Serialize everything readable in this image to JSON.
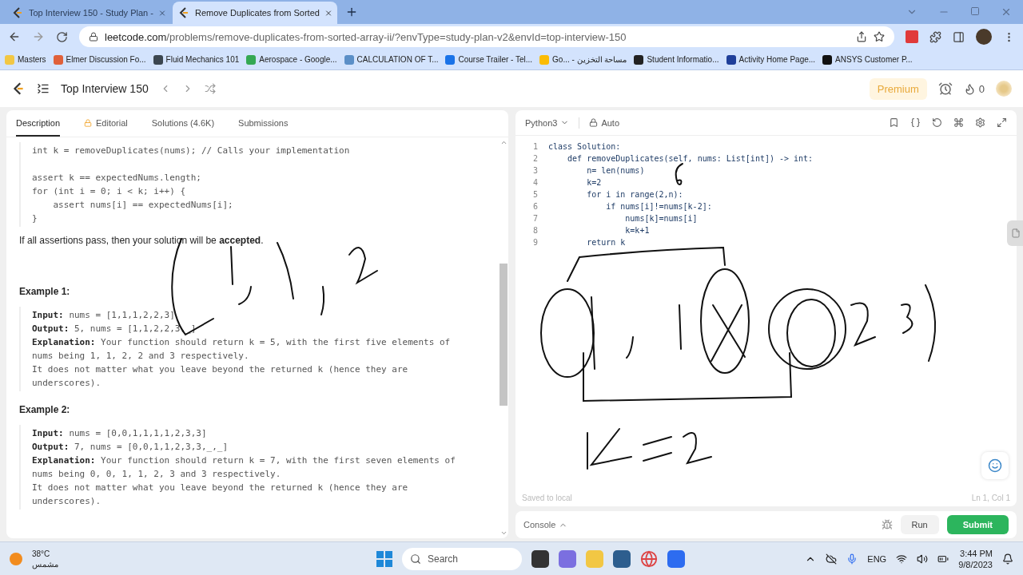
{
  "browser": {
    "tabs": [
      {
        "title": "Top Interview 150 - Study Plan -",
        "selected": false
      },
      {
        "title": "Remove Duplicates from Sorted",
        "selected": true
      }
    ],
    "url_host": "leetcode.com",
    "url_path": "/problems/remove-duplicates-from-sorted-array-ii/?envType=study-plan-v2&envId=top-interview-150",
    "bookmarks": [
      {
        "label": "Masters",
        "color": "#f2c744"
      },
      {
        "label": "Elmer Discussion Fo...",
        "color": "#e0603a"
      },
      {
        "label": "Fluid Mechanics 101",
        "color": "#3b4650"
      },
      {
        "label": "Aerospace - Google...",
        "color": "#34a853"
      },
      {
        "label": "CALCULATION OF T...",
        "color": "#5b8fc7"
      },
      {
        "label": "Course Trailer - Tel...",
        "color": "#1a73e8"
      },
      {
        "label": "Go... - مساحة التخزين",
        "color": "#fbbc04"
      },
      {
        "label": "Student Informatio...",
        "color": "#222222"
      },
      {
        "label": "Activity Home Page...",
        "color": "#1f3f9a"
      },
      {
        "label": "ANSYS Customer P...",
        "color": "#111111"
      }
    ]
  },
  "header": {
    "title": "Top Interview 150",
    "premium": "Premium",
    "streak": "0"
  },
  "description": {
    "tabs": [
      {
        "label": "Description",
        "selected": true,
        "locked": false
      },
      {
        "label": "Editorial",
        "selected": false,
        "locked": true
      },
      {
        "label": "Solutions (4.6K)",
        "selected": false,
        "locked": false
      },
      {
        "label": "Submissions",
        "selected": false,
        "locked": false
      }
    ],
    "code_groups": [
      [
        "int k = removeDuplicates(nums); // Calls your implementation"
      ],
      [
        "assert k == expectedNums.length;",
        "for (int i = 0; i < k; i++) {",
        "    assert nums[i] == expectedNums[i];",
        "}"
      ]
    ],
    "paragraph": "If all assertions pass, then your solution will be **accepted**.",
    "examples": [
      {
        "title": "Example 1:",
        "input_label": "Input:",
        "output_label": "Output:",
        "explanation_label": "Explanation:",
        "input": "nums = [1,1,1,2,2,3]",
        "output": "5, nums = [1,1,2,2,3,_]",
        "explanation": [
          "Your function should return k = 5, with the first five elements of",
          "nums being 1, 1, 2, 2 and 3 respectively.",
          "It does not matter what you leave beyond the returned k (hence they are",
          "underscores)."
        ]
      },
      {
        "title": "Example 2:",
        "input_label": "Input:",
        "output_label": "Output:",
        "explanation_label": "Explanation:",
        "input": "nums = [0,0,1,1,1,1,2,3,3]",
        "output": "7, nums = [0,0,1,1,2,3,3,_,_]",
        "explanation": [
          "Your function should return k = 7, with the first seven elements of",
          "nums being 0, 0, 1, 1, 2, 3 and 3 respectively.",
          "It does not matter what you leave beyond the returned k (hence they are",
          "underscores)."
        ]
      }
    ]
  },
  "editor": {
    "language": "Python3",
    "mode": "Auto",
    "lines": [
      {
        "number": "1",
        "text": "class Solution:"
      },
      {
        "number": "2",
        "text": "    def removeDuplicates(self, nums: List[int]) -> int:"
      },
      {
        "number": "3",
        "text": "        n= len(nums)"
      },
      {
        "number": "4",
        "text": "        k=2"
      },
      {
        "number": "5",
        "text": "        for i in range(2,n):"
      },
      {
        "number": "6",
        "text": "            if nums[i]!=nums[k-2]:"
      },
      {
        "number": "7",
        "text": "                nums[k]=nums[i]"
      },
      {
        "number": "8",
        "text": "                k=k+1"
      },
      {
        "number": "9",
        "text": "        return k"
      }
    ],
    "saved": "Saved to local",
    "position": "Ln 1, Col 1"
  },
  "console": {
    "label": "Console",
    "run": "Run",
    "submit": "Submit"
  },
  "taskbar": {
    "temperature": "38°C",
    "weather": "مشمس",
    "search_placeholder": "Search",
    "language": "ENG",
    "time": "3:44 PM",
    "date": "9/8/2023"
  }
}
